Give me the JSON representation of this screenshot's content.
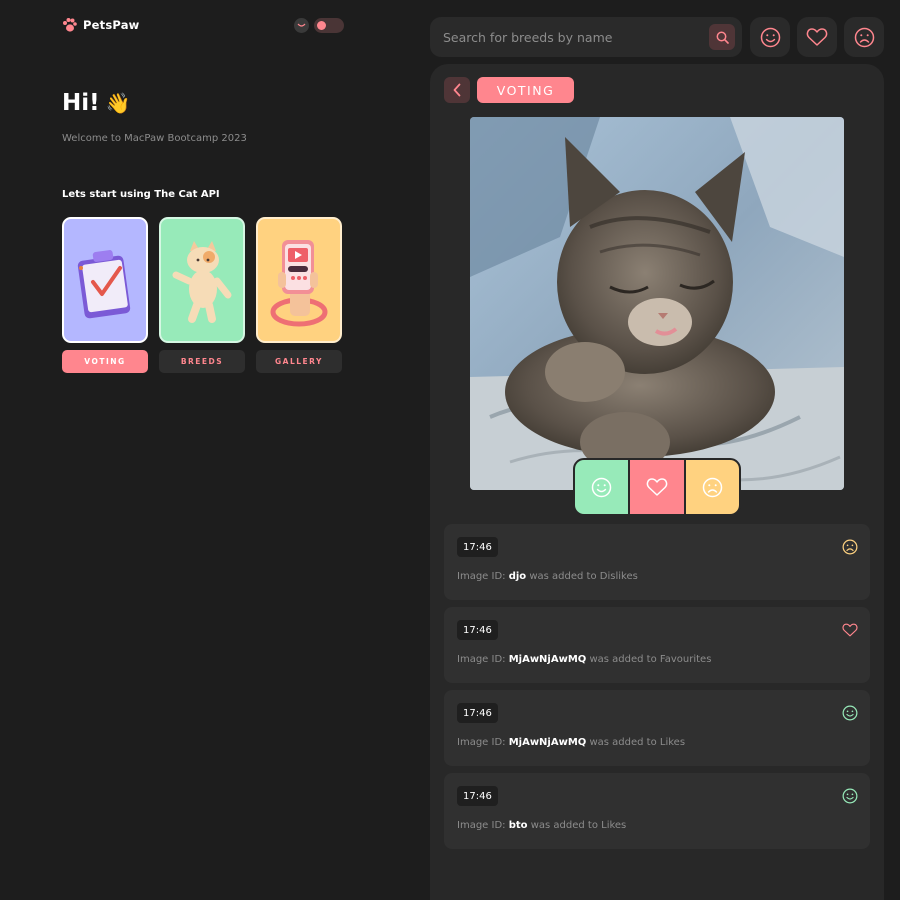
{
  "app": {
    "logo_text": "PetsPaw"
  },
  "left": {
    "greeting": "Hi!",
    "wave": "👋",
    "welcome": "Welcome to MacPaw Bootcamp 2023",
    "subhead": "Lets start using The Cat API",
    "cards": [
      {
        "label": "VOTING",
        "active": true
      },
      {
        "label": "BREEDS",
        "active": false
      },
      {
        "label": "GALLERY",
        "active": false
      }
    ]
  },
  "topbar": {
    "search_placeholder": "Search for breeds by name",
    "icons": [
      "smile-icon",
      "heart-icon",
      "sad-icon"
    ]
  },
  "panel": {
    "breadcrumb": "VOTING",
    "photo_icon": "sleeping-kitten-photo",
    "vote_buttons": [
      "like",
      "favourite",
      "dislike"
    ],
    "log": [
      {
        "time": "17:46",
        "prefix": "Image ID:",
        "id": "djo",
        "suffix": "was added to Dislikes",
        "icon": "sad-icon"
      },
      {
        "time": "17:46",
        "prefix": "Image ID:",
        "id": "MjAwNjAwMQ",
        "suffix": "was added to Favourites",
        "icon": "heart-icon"
      },
      {
        "time": "17:46",
        "prefix": "Image ID:",
        "id": "MjAwNjAwMQ",
        "suffix": "was added to Likes",
        "icon": "smile-icon"
      },
      {
        "time": "17:46",
        "prefix": "Image ID:",
        "id": "bto",
        "suffix": "was added to Likes",
        "icon": "smile-icon"
      }
    ]
  },
  "colors": {
    "accent": "#ff868e",
    "like": "#97eab9",
    "dislike": "#ffd280",
    "voting_card": "#b4b7ff",
    "background": "#1d1d1d",
    "panel": "#282828"
  }
}
